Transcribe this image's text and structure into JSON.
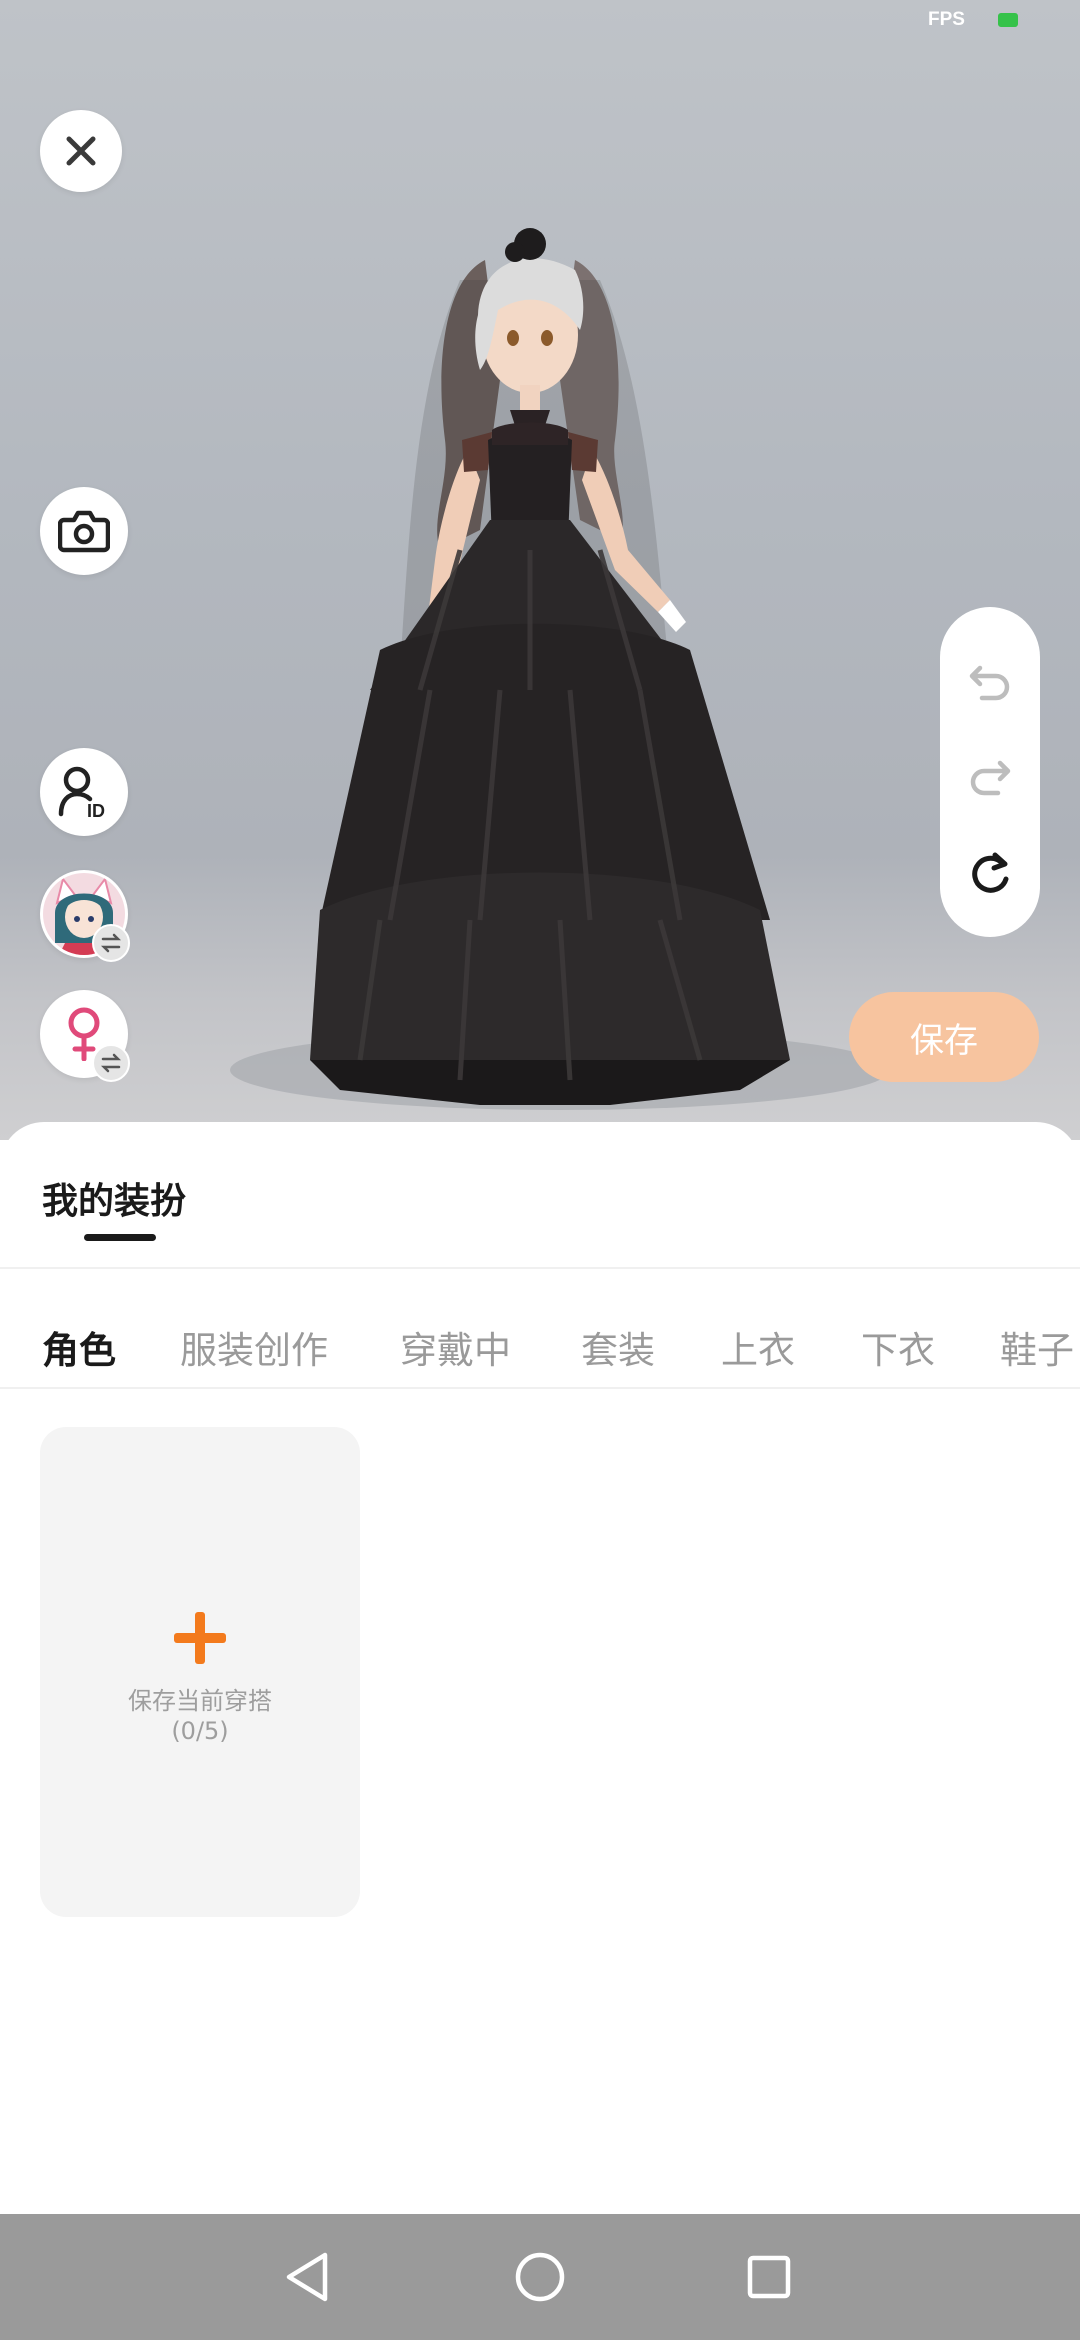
{
  "status": {
    "fps_label": "FPS",
    "fps_indicator_color": "#36c24a"
  },
  "scene": {
    "close_icon": "close-icon",
    "camera_icon": "camera-icon",
    "id_icon": "user-id-icon",
    "avatar_icon": "avatar-switch",
    "gender_icon": "female-icon",
    "history": [
      "undo-icon",
      "redo-icon",
      "reset-icon"
    ],
    "save_label": "保存",
    "save_color": "#f7c49f"
  },
  "sheet": {
    "title": "我的装扮",
    "tabs": [
      "角色",
      "服装创作",
      "穿戴中",
      "套装",
      "上衣",
      "下衣",
      "鞋子"
    ],
    "active_tab": 0,
    "card": {
      "label": "保存当前穿搭",
      "count": "(0/5)",
      "accent": "#f37a1c"
    }
  },
  "navbar": {
    "keys": [
      "back-icon",
      "home-icon",
      "recents-icon"
    ]
  }
}
